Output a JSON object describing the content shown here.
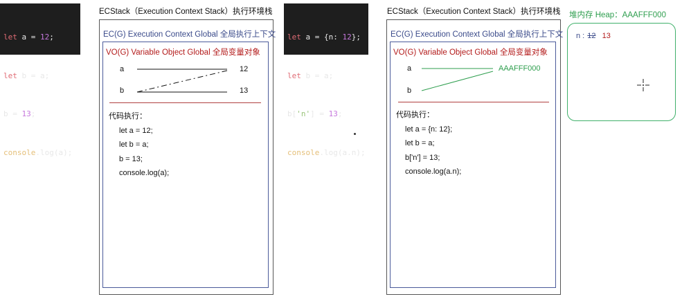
{
  "left": {
    "code": {
      "line1": {
        "kw": "let",
        "rest1": " a = ",
        "num": "12",
        "end": ";"
      },
      "line2": {
        "kw": "let",
        "rest": " b = a;"
      },
      "line3": {
        "pre": "b = ",
        "num": "13",
        "end": ";"
      },
      "line4": {
        "fn": "console",
        "rest": ".log(a);"
      }
    },
    "title": "ECStack（Execution Context Stack）执行环境栈",
    "ec_label": "EC(G)  Execution Context Global  全局执行上下文",
    "vo_label": "VO(G)  Variable  Object Global 全局变量对象",
    "var_a": "a",
    "var_b": "b",
    "val_a": "12",
    "val_b": "13",
    "exec_title": "代码执行：",
    "exec_lines": [
      "let a = 12;",
      "let b = a;",
      "b = 13;",
      "console.log(a);"
    ]
  },
  "right": {
    "code": {
      "line1": {
        "kw": "let",
        "rest1": " a = {n: ",
        "num": "12",
        "end": "};"
      },
      "line2": {
        "kw": "let",
        "rest": " b = a;"
      },
      "line3": {
        "pre": "b[",
        "str": "'n'",
        "mid": "] = ",
        "num": "13",
        "end": ";"
      },
      "line4": {
        "fn": "console",
        "rest": ".log(a.n);"
      }
    },
    "title": "ECStack（Execution Context Stack）执行环境栈",
    "ec_label": "EC(G)  Execution Context Global  全局执行上下文",
    "vo_label": "VO(G)  Variable  Object Global 全局变量对象",
    "var_a": "a",
    "var_b": "b",
    "addr": "AAAFFF000",
    "exec_title": "代码执行：",
    "exec_lines": [
      "let a = {n: 12};",
      "let b = a;",
      "b['n'] = 13;",
      "console.log(a.n);"
    ]
  },
  "heap": {
    "title": "堆内存 Heap：AAAFFF000",
    "key": "n :",
    "old_value": "12",
    "new_value": "13"
  },
  "colors": {
    "code_bg": "#1e1e1e",
    "ec_blue": "#3a4a8a",
    "vo_red": "#b31b1b",
    "heap_green": "#2e9e4e"
  }
}
